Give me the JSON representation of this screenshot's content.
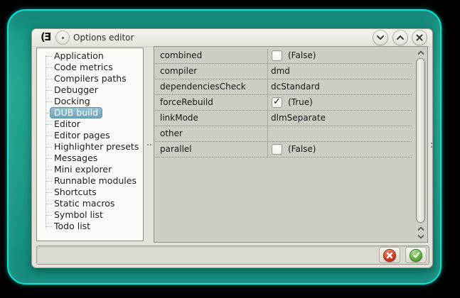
{
  "titlebar": {
    "title": "Options editor",
    "app_logo_text": "(Ǝ"
  },
  "icons": {
    "check": "✓"
  },
  "sidebar": {
    "items": [
      {
        "label": "Application",
        "selected": false
      },
      {
        "label": "Code metrics",
        "selected": false
      },
      {
        "label": "Compilers paths",
        "selected": false
      },
      {
        "label": "Debugger",
        "selected": false
      },
      {
        "label": "Docking",
        "selected": false
      },
      {
        "label": "DUB build",
        "selected": true
      },
      {
        "label": "Editor",
        "selected": false
      },
      {
        "label": "Editor pages",
        "selected": false
      },
      {
        "label": "Highlighter presets",
        "selected": false
      },
      {
        "label": "Messages",
        "selected": false
      },
      {
        "label": "Mini explorer",
        "selected": false
      },
      {
        "label": "Runnable modules",
        "selected": false
      },
      {
        "label": "Shortcuts",
        "selected": false
      },
      {
        "label": "Static macros",
        "selected": false
      },
      {
        "label": "Symbol list",
        "selected": false
      },
      {
        "label": "Todo list",
        "selected": false
      }
    ]
  },
  "grid": {
    "rows": [
      {
        "name": "combined",
        "control": "checkbox",
        "checked": false,
        "value": "(False)"
      },
      {
        "name": "compiler",
        "control": "text",
        "value": "dmd"
      },
      {
        "name": "dependenciesCheck",
        "control": "text",
        "value": "dcStandard"
      },
      {
        "name": "forceRebuild",
        "control": "checkbox",
        "checked": true,
        "value": "(True)"
      },
      {
        "name": "linkMode",
        "control": "text",
        "value": "dlmSeparate"
      },
      {
        "name": "other",
        "control": "text",
        "value": ""
      },
      {
        "name": "parallel",
        "control": "checkbox",
        "checked": false,
        "value": "(False)"
      }
    ]
  },
  "footer": {
    "cancel_icon": "x-in-red-circle",
    "ok_icon": "check-in-green-circle"
  },
  "colors": {
    "screen_border": "#00e8da",
    "screen_fill": "#1f9e8b",
    "window_bg": "#e2e2da",
    "grid_bg": "#cdcdc4",
    "selection": "#7fb2c4",
    "cancel_red": "#cf3b1f",
    "ok_green": "#5cae3e"
  }
}
